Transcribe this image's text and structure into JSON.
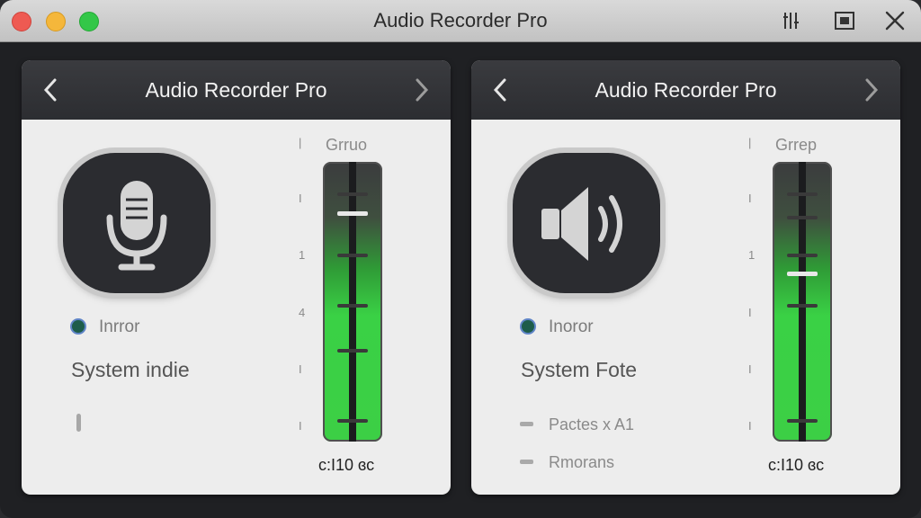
{
  "window": {
    "title": "Audio Recorder Pro"
  },
  "panels": [
    {
      "title": "Audio Recorder Pro",
      "icon": "microphone-icon",
      "status_label": "Inrror",
      "source_name": "System indie",
      "meter": {
        "title": "Grruo",
        "level": 0.82,
        "readout": "c:I10 ɞc"
      },
      "list": []
    },
    {
      "title": "Audio Recorder Pro",
      "icon": "speaker-icon",
      "status_label": "Inoror",
      "source_name": "System Fote",
      "meter": {
        "title": "Grrep",
        "level": 0.6,
        "readout": "c:I10 ɞc"
      },
      "list": [
        "Pactes x A1",
        "Rmorans"
      ]
    }
  ],
  "colors": {
    "meter_green": "#3ccf45",
    "status_dot": "#1d5c4a",
    "header_dark": "#2c2d31"
  }
}
